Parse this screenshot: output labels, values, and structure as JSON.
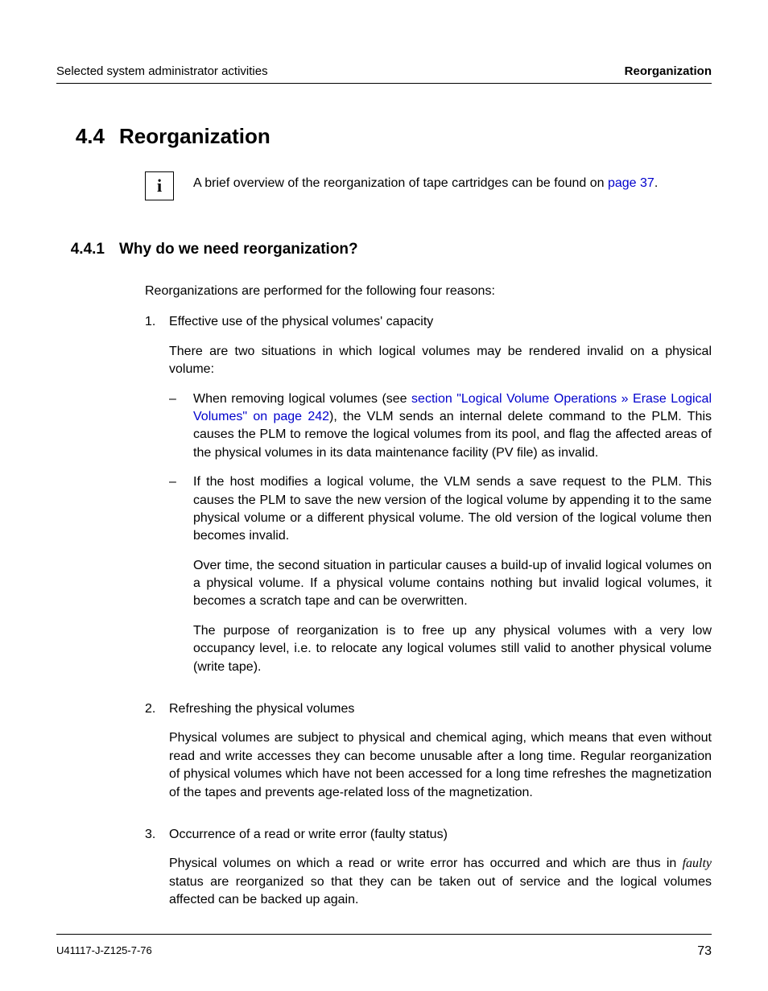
{
  "header": {
    "left": "Selected system administrator activities",
    "right": "Reorganization"
  },
  "section": {
    "number": "4.4",
    "title": "Reorganization"
  },
  "info": {
    "icon_alt": "i",
    "text_before_link": "A brief overview of the reorganization of tape cartridges can be found on ",
    "link_text": "page 37",
    "text_after_link": "."
  },
  "subsection": {
    "number": "4.4.1",
    "title": "Why do we need reorganization?"
  },
  "intro": "Reorganizations are performed for the following four reasons:",
  "items": [
    {
      "marker": "1.",
      "title": "Effective use of the physical volumes' capacity",
      "para1": "There are two situations in which logical volumes may be rendered invalid on a physical volume:",
      "bullets": [
        {
          "pre_link": "When removing logical volumes (see ",
          "link": "section \"Logical Volume Operations » Erase Logical Volumes\" on page 242",
          "post_link": "), the VLM sends an internal delete command to the PLM. This causes the PLM to remove the logical volumes from its pool, and flag the affected areas of the physical volumes in its data maintenance facility (PV file) as invalid."
        },
        {
          "paras": [
            "If the host modifies a logical volume, the VLM sends a save request to the PLM. This causes the PLM to save the new version of the logical volume by appending it to the same physical volume or a different physical volume. The old version of the logical volume then becomes invalid.",
            "Over time, the second situation in particular causes a build-up of invalid logical volumes on a physical volume. If a physical volume contains nothing but invalid logical volumes, it becomes a scratch tape and can be overwritten.",
            "The purpose of reorganization is to free up any physical volumes with a very low occupancy level, i.e. to relocate any logical volumes still valid to another physical volume (write tape)."
          ]
        }
      ]
    },
    {
      "marker": "2.",
      "title": "Refreshing the physical volumes",
      "para1": "Physical volumes are subject to physical and chemical aging, which means that even without read and write accesses they can become unusable after a long time. Regular reorganization of physical volumes which have not been accessed for a long time refreshes the magnetization of the tapes and prevents age-related loss of the magnetization."
    },
    {
      "marker": "3.",
      "title": "Occurrence of a read or write error (faulty status)",
      "para_pre_em": "Physical volumes on which a read or write error has occurred and which are thus in ",
      "em": "faulty",
      "para_post_em": " status are reorganized so that they can be taken out of service and the logical volumes affected can be backed up again."
    }
  ],
  "footer": {
    "doc_id": "U41117-J-Z125-7-76",
    "page": "73"
  }
}
